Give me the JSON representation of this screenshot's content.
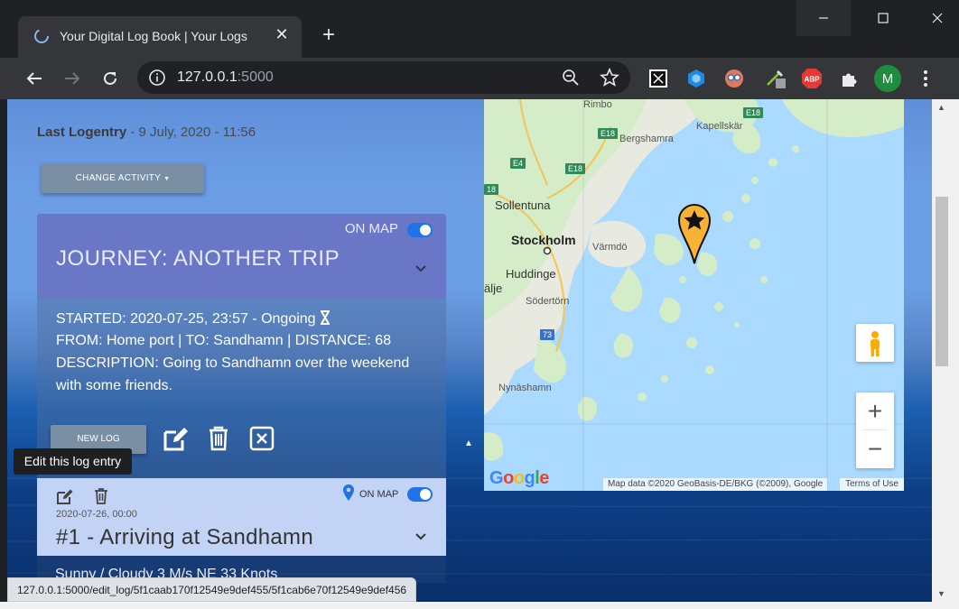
{
  "browser": {
    "tab_title": "Your Digital Log Book | Your Logs",
    "url_host": "127.0.0.1",
    "url_port": ":5000",
    "profile_initial": "M",
    "abp_label": "ABP",
    "status_url": "127.0.0.1:5000/edit_log/5f1caab170f12549e9def455/5f1cab6e70f12549e9def456"
  },
  "page": {
    "last_logentry_label": "Last Logentry",
    "last_logentry_value": " - 9 July, 2020 - 11:56",
    "change_activity_label": "CHANGE ACTIVITY"
  },
  "journey": {
    "on_map_label": "ON MAP",
    "title": "JOURNEY: ANOTHER TRIP",
    "started": "STARTED: 2020-07-25, 23:57 - Ongoing",
    "route": "FROM: Home port | TO: Sandhamn | DISTANCE: 68",
    "description_1": "DESCRIPTION: Going to Sandhamn over the weekend",
    "description_2": "with some friends.",
    "new_log_label": "NEW LOG"
  },
  "tooltip": "Edit this log entry",
  "entry": {
    "on_map_label": "ON MAP",
    "date": "2020-07-26, 00:00",
    "title": "#1 - Arriving at Sandhamn",
    "next_row_partial": "Sunny / Cloudy    3 M/s    NE    33 Knots"
  },
  "map": {
    "labels": {
      "rimbo": "Rimbo",
      "bergshamra": "Bergshamra",
      "kapellskar": "Kapellskär",
      "sollentuna": "Sollentuna",
      "stockholm": "Stockholm",
      "varmdo": "Värmdö",
      "huddinge": "Huddinge",
      "alje": "älje",
      "sodertorn": "Södertörn",
      "nynashamn": "Nynäshamn"
    },
    "roads": [
      "E18",
      "E18",
      "E4",
      "E18",
      "18",
      "73"
    ],
    "attribution": "Map data ©2020 GeoBasis-DE/BKG (©2009), Google",
    "terms": "Terms of Use",
    "google": "Google",
    "zoom_in": "+",
    "zoom_out": "−"
  },
  "colors": {
    "journey_header": "#6a77c6",
    "entry_card": "#c3d3f6",
    "toggle": "#1e73e8",
    "button": "#7b8fa4",
    "marker": "#f9b233"
  }
}
